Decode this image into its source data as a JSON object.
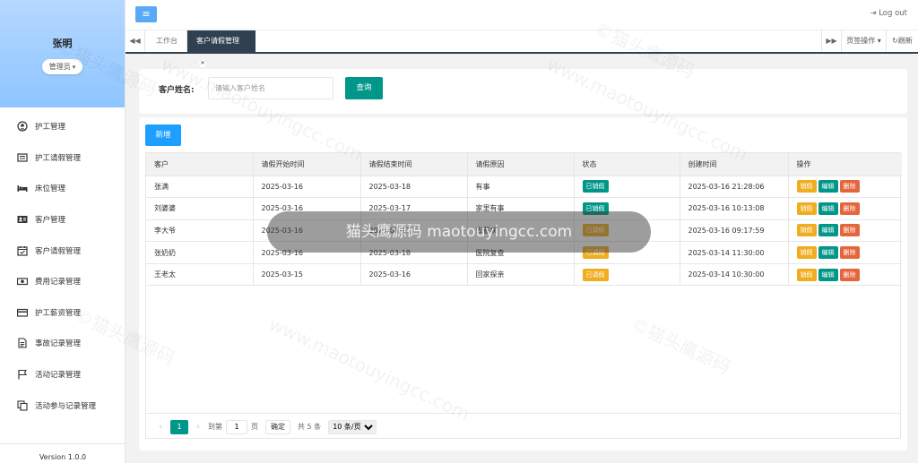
{
  "colors": {
    "teal": "#009688",
    "blue": "#1e9fff",
    "yellow": "#f0ad1f",
    "red": "#e3663d",
    "dark": "#2f4050",
    "profile_bg": "#8ec5ff"
  },
  "sidebar": {
    "user_name": "张明",
    "role": "管理员",
    "version": "Version 1.0.0",
    "items": [
      {
        "icon": "person-circle-icon",
        "label": "护工管理"
      },
      {
        "icon": "list-icon",
        "label": "护工请假管理"
      },
      {
        "icon": "bed-icon",
        "label": "床位管理"
      },
      {
        "icon": "contact-card-icon",
        "label": "客户管理"
      },
      {
        "icon": "calendar-check-icon",
        "label": "客户请假管理"
      },
      {
        "icon": "money-icon",
        "label": "费用记录管理"
      },
      {
        "icon": "credit-card-icon",
        "label": "护工薪资管理"
      },
      {
        "icon": "document-icon",
        "label": "事故记录管理"
      },
      {
        "icon": "flag-icon",
        "label": "活动记录管理"
      },
      {
        "icon": "copy-icon",
        "label": "活动参与记录管理"
      }
    ]
  },
  "topbar": {
    "logout": "Log out"
  },
  "tabs": {
    "home": "工作台",
    "active": "客户请假管理",
    "ops": "页签操作",
    "refresh": "刷新"
  },
  "search": {
    "label": "客户姓名:",
    "placeholder": "请输入客户姓名",
    "button": "查询"
  },
  "table": {
    "add_button": "新增",
    "columns": [
      "客户",
      "请假开始时间",
      "请假结束时间",
      "请假原因",
      "状态",
      "创建时间",
      "操作"
    ],
    "rows": [
      {
        "customer": "张满",
        "start": "2025-03-16",
        "end": "2025-03-18",
        "reason": "有事",
        "status": "已销假",
        "created": "2025-03-16 21:28:06"
      },
      {
        "customer": "刘婆婆",
        "start": "2025-03-16",
        "end": "2025-03-17",
        "reason": "家里有事",
        "status": "已销假",
        "created": "2025-03-16 10:13:08"
      },
      {
        "customer": "李大爷",
        "start": "2025-03-16",
        "end": "2025-03-17",
        "reason": "去看病",
        "status": "已请假",
        "created": "2025-03-16 09:17:59"
      },
      {
        "customer": "张奶奶",
        "start": "2025-03-16",
        "end": "2025-03-18",
        "reason": "医院复查",
        "status": "已请假",
        "created": "2025-03-14 11:30:00"
      },
      {
        "customer": "王老太",
        "start": "2025-03-15",
        "end": "2025-03-16",
        "reason": "回家探亲",
        "status": "已请假",
        "created": "2025-03-14 10:30:00"
      }
    ],
    "actions": {
      "cancel": "销假",
      "edit": "编辑",
      "delete": "删除"
    }
  },
  "pager": {
    "current_page": "1",
    "goto_label": "到第",
    "goto_value": "1",
    "page_unit": "页",
    "confirm": "确定",
    "total": "共 5 条",
    "page_size": "10 条/页"
  },
  "watermark": {
    "text": "©猫头鹰源码",
    "url": "www.maotouyingcc.com",
    "pill": "猫头鹰源码 maotouyingcc.com"
  }
}
